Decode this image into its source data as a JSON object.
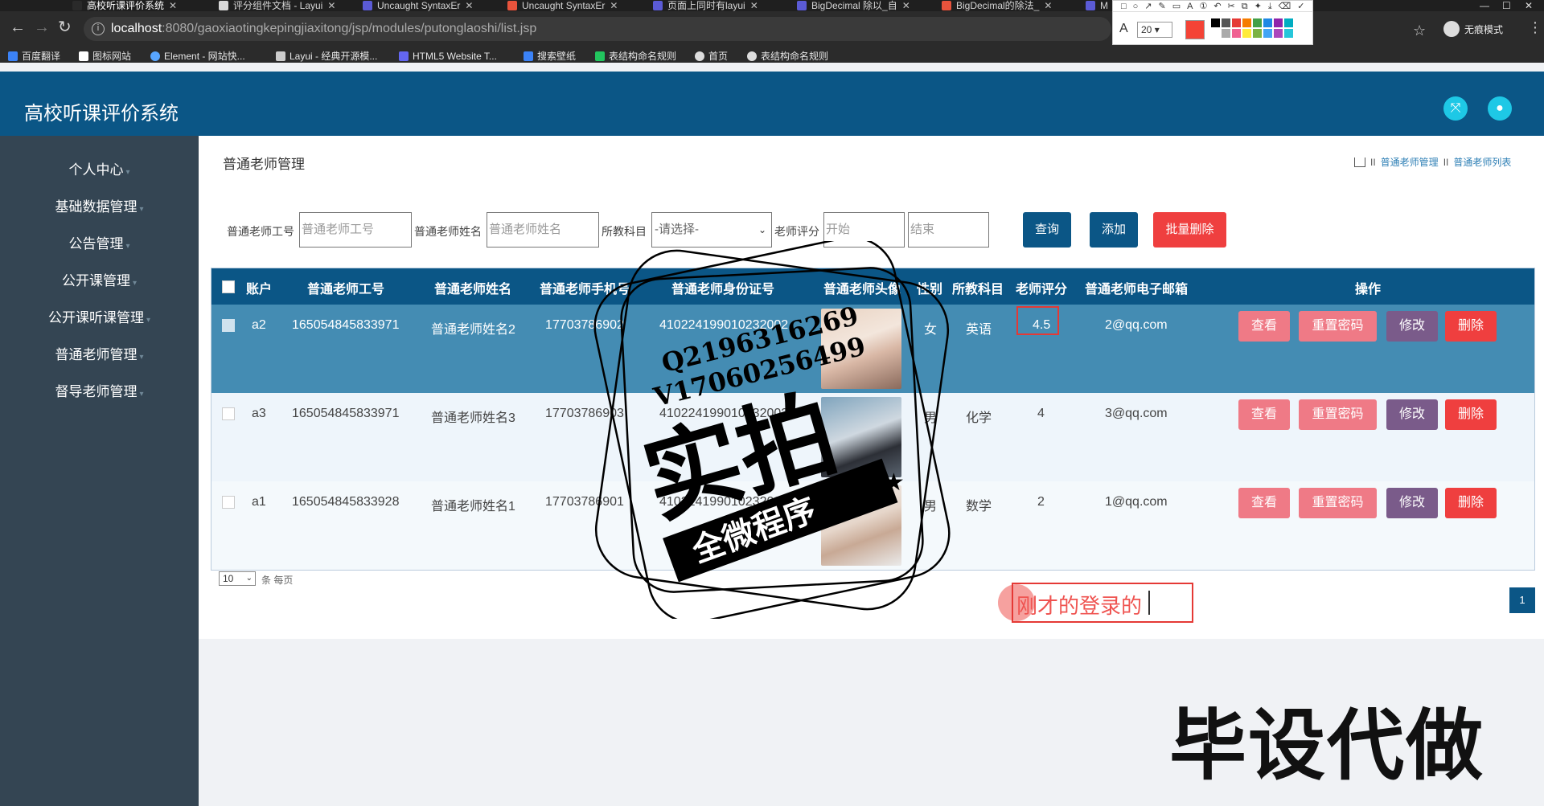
{
  "browser": {
    "tabs": [
      {
        "title": "高校听课评价系统",
        "color": "#ffffff"
      },
      {
        "title": "评分组件文档 - Layui",
        "color": "#d8d8d8"
      },
      {
        "title": "Uncaught SyntaxEr",
        "color": "#5b5bd6"
      },
      {
        "title": "Uncaught SyntaxEr",
        "color": "#e8533c"
      },
      {
        "title": "页面上同时有layui",
        "color": "#5b5bd6"
      },
      {
        "title": "BigDecimal 除以_自",
        "color": "#5b5bd6"
      },
      {
        "title": "BigDecimal的除法_",
        "color": "#e8533c"
      },
      {
        "title": "M",
        "color": "#5b5bd6"
      }
    ],
    "url_host": "localhost",
    "url_path": ":8080/gaoxiaotingkepingjiaxitong/jsp/modules/putonglaoshi/list.jsp",
    "incognito_label": "无痕模式",
    "draw_toolbar": {
      "font_size": "20",
      "current_color": "#f44336",
      "palette": [
        "#000000",
        "#555555",
        "#e53935",
        "#f57c00",
        "#43a047",
        "#1e88e5",
        "#8e24aa",
        "#00acc1",
        "#ffffff",
        "#aaaaaa",
        "#f06292",
        "#ffeb3b",
        "#7cb342",
        "#42a5f5",
        "#ab47bc",
        "#26c6da"
      ]
    },
    "bookmarks": [
      {
        "label": "百度翻译",
        "color": "#3b82f6"
      },
      {
        "label": "图标网站",
        "color": "#ffffff"
      },
      {
        "label": "Element - 网站快...",
        "color": "#58a6ff"
      },
      {
        "label": "Layui - 经典开源模...",
        "color": "#cccccc"
      },
      {
        "label": "HTML5 Website T...",
        "color": "#6366f1"
      },
      {
        "label": "搜索壁纸",
        "color": "#3b82f6"
      },
      {
        "label": "表结构命名规则",
        "color": "#22c55e"
      },
      {
        "label": "首页",
        "color": "#dddddd"
      },
      {
        "label": "表结构命名规则",
        "color": "#dddddd"
      }
    ]
  },
  "app": {
    "title": "高校听课评价系统",
    "sidebar": [
      {
        "label": "个人中心"
      },
      {
        "label": "基础数据管理"
      },
      {
        "label": "公告管理"
      },
      {
        "label": "公开课管理"
      },
      {
        "label": "公开课听课管理"
      },
      {
        "label": "普通老师管理"
      },
      {
        "label": "督导老师管理"
      }
    ],
    "page_heading": "普通老师管理",
    "breadcrumb": [
      "普通老师管理",
      "普通老师列表"
    ],
    "breadcrumb_sep": "II",
    "filters": {
      "id_label": "普通老师工号",
      "id_placeholder": "普通老师工号",
      "name_label": "普通老师姓名",
      "name_placeholder": "普通老师姓名",
      "subject_label": "所教科目",
      "subject_value": "-请选择-",
      "score_label": "老师评分",
      "score_start_placeholder": "开始",
      "score_end_placeholder": "结束"
    },
    "buttons": {
      "query": "查询",
      "add": "添加",
      "batch_delete": "批量删除"
    },
    "table": {
      "headers": [
        "账户",
        "普通老师工号",
        "普通老师姓名",
        "普通老师手机号",
        "普通老师身份证号",
        "普通老师头像",
        "性别",
        "所教科目",
        "老师评分",
        "普通老师电子邮箱",
        "操作"
      ],
      "rows": [
        {
          "account": "a2",
          "id": "165054845833971",
          "name": "普通老师姓名2",
          "phone": "17703786902",
          "idcard": "410224199010232002",
          "gender": "女",
          "subject": "英语",
          "score": "4.5",
          "email": "2@qq.com"
        },
        {
          "account": "a3",
          "id": "165054845833971",
          "name": "普通老师姓名3",
          "phone": "17703786903",
          "idcard": "410224199010232003",
          "gender": "男",
          "subject": "化学",
          "score": "4",
          "email": "3@qq.com"
        },
        {
          "account": "a1",
          "id": "165054845833928",
          "name": "普通老师姓名1",
          "phone": "17703786901",
          "idcard": "410224199010232001",
          "gender": "男",
          "subject": "数学",
          "score": "2",
          "email": "1@qq.com"
        }
      ],
      "actions": {
        "view": "查看",
        "reset": "重置密码",
        "edit": "修改",
        "delete": "删除"
      }
    },
    "pager": {
      "page_size": "10",
      "page_size_label": "条 每页",
      "current_page": "1"
    }
  },
  "overlays": {
    "annotation_text": "刚才的登录的",
    "stamp": {
      "line1": "Q2196316269",
      "line2": "V17060256499",
      "main": "实拍",
      "ribbon": "全微程序"
    },
    "watermark": "毕设代做"
  }
}
